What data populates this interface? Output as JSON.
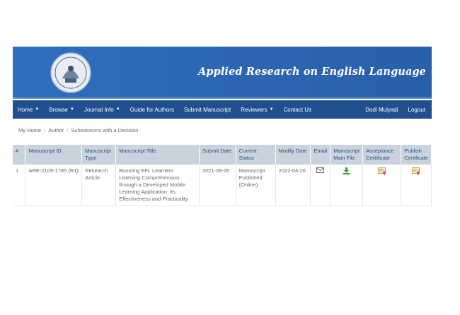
{
  "site": {
    "title": "Applied Research on English Language"
  },
  "nav": {
    "left": [
      {
        "label": "Home",
        "dropdown": true
      },
      {
        "label": "Browse",
        "dropdown": true
      },
      {
        "label": "Journal Info",
        "dropdown": true
      },
      {
        "label": "Guide for Authors",
        "dropdown": false
      },
      {
        "label": "Submit Manuscript",
        "dropdown": false
      },
      {
        "label": "Reviewers",
        "dropdown": true
      },
      {
        "label": "Contact Us",
        "dropdown": false
      }
    ],
    "user": "Dodi Mulyadi",
    "logout": "Logout"
  },
  "breadcrumb": [
    "My Home",
    "Author",
    "Submissions with a Decision"
  ],
  "table": {
    "headers": [
      "#",
      "Manuscript ID",
      "Manuscript Type",
      "Manuscript Title",
      "Submit Date",
      "Current Status",
      "Modify Date",
      "Email",
      "Manuscript Main File",
      "Acceptance Certificate",
      "Publish Certificate"
    ],
    "rows": [
      {
        "num": "1",
        "id": "ARE-2109-1785 (R1)",
        "type": "Research Article",
        "title": "Boosting EFL Learners' Listening Comprehension through a Developed Mobile Learning Application: Its Effectiveness and Practicality",
        "submit_date": "2021-09-26",
        "status": "Manuscript Published (Online)",
        "modify_date": "2022-04-26"
      }
    ]
  },
  "colors": {
    "banner": "#2c67b4",
    "navbar": "#1f4f8e",
    "header_bg": "#c9d3dd",
    "download_green": "#3aa035"
  },
  "icons": {
    "email": "envelope-icon",
    "main_file": "download-icon",
    "acceptance": "certificate-icon",
    "publish": "certificate-icon"
  }
}
